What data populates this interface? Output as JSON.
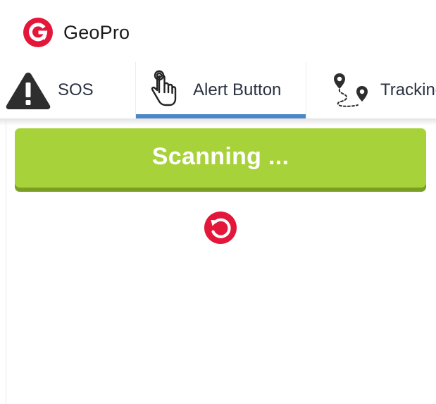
{
  "app": {
    "name": "GeoPro",
    "brand_color": "#e4163a",
    "logo_icon": "geopro-logo-icon"
  },
  "tabs": [
    {
      "id": "sos",
      "label": "SOS",
      "icon": "warning-icon",
      "selected": false
    },
    {
      "id": "alert",
      "label": "Alert Button",
      "icon": "hand-pointer-icon",
      "selected": true
    },
    {
      "id": "tracking",
      "label": "Tracking",
      "icon": "route-pins-icon",
      "selected": false
    }
  ],
  "colors": {
    "tab_indicator": "#4a86c8",
    "scan_button": "#a8d23a",
    "scan_button_shadow": "#7a9f23",
    "refresh_icon": "#e4163a"
  },
  "main": {
    "scan_button_label": "Scanning ...",
    "refresh_icon": "refresh-icon"
  }
}
